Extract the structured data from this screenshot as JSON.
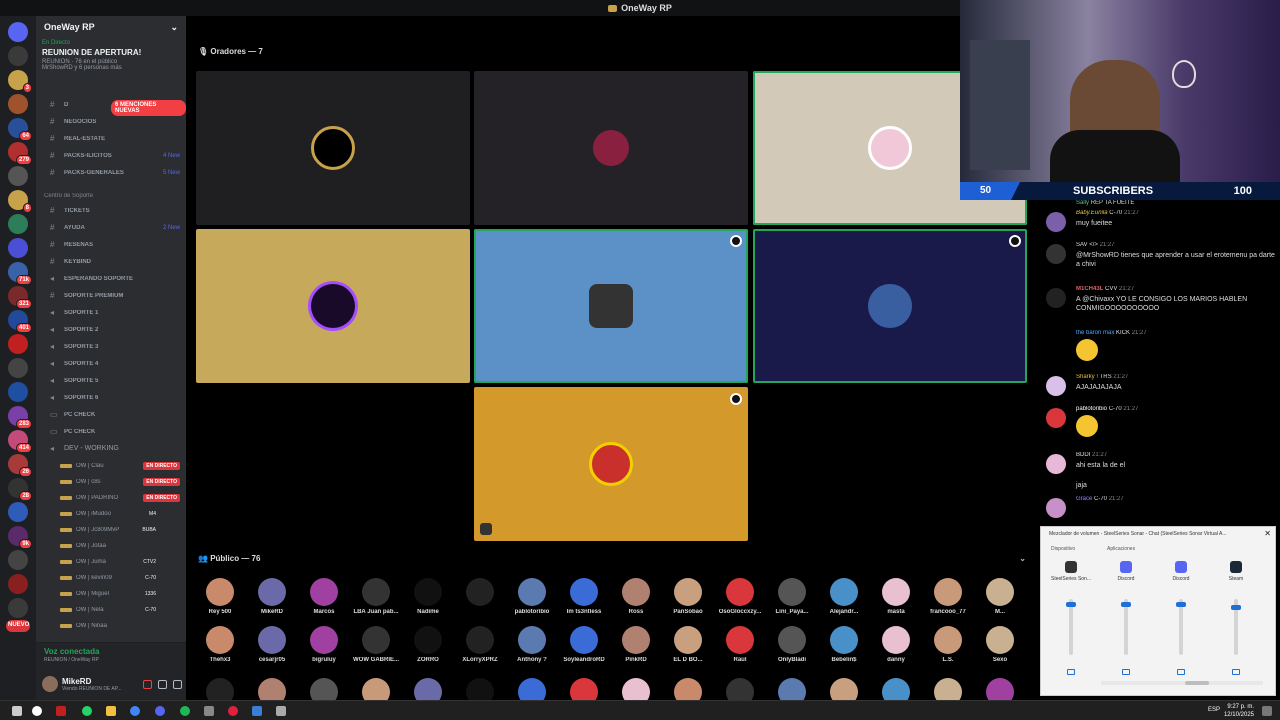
{
  "window": {
    "title": "OneWay RP"
  },
  "rail": {
    "badges": [
      "3",
      "64",
      "279",
      "8",
      "71k",
      "321",
      "401",
      "283",
      "414",
      "26",
      "28",
      "9k",
      "NUEVO"
    ]
  },
  "sidebar": {
    "server_name": "OneWay RP",
    "event": {
      "live_label": "En Directo",
      "title": "REUNION DE APERTURA!",
      "meta": "REUNION · 76 en el público",
      "hosts": "MrShowRD y 6 personas más"
    },
    "mentions_pill": "6 MENCIONES NUEVAS",
    "channels": [
      {
        "name": "D",
        "new": ""
      },
      {
        "name": "NEGOCIOS",
        "new": ""
      },
      {
        "name": "REAL-ESTATE",
        "new": ""
      },
      {
        "name": "PACKS-ILÍCITOS",
        "new": "4 New"
      },
      {
        "name": "PACKS-GENERALES",
        "new": "5 New"
      },
      {
        "name": "Centro de Soporte",
        "new": ""
      },
      {
        "name": "TICKETS",
        "new": ""
      },
      {
        "name": "AYUDA",
        "new": "2 New"
      },
      {
        "name": "RESEÑAS",
        "new": ""
      },
      {
        "name": "KEYBIND",
        "new": ""
      },
      {
        "name": "ESPERANDO SOPORTE",
        "new": ""
      },
      {
        "name": "SOPORTE PREMIUM",
        "new": ""
      },
      {
        "name": "SOPORTE 1",
        "new": ""
      },
      {
        "name": "SOPORTE 2",
        "new": ""
      },
      {
        "name": "SOPORTE 3",
        "new": ""
      },
      {
        "name": "SOPORTE 4",
        "new": ""
      },
      {
        "name": "SOPORTE 5",
        "new": ""
      },
      {
        "name": "SOPORTE 6",
        "new": ""
      },
      {
        "name": "PC CHECK",
        "new": ""
      },
      {
        "name": "PC CHECK",
        "new": ""
      },
      {
        "name": "DEV - WORKING",
        "new": ""
      }
    ],
    "voice_members": [
      {
        "name": "OW | Clau",
        "tag": "EN DIRECTO"
      },
      {
        "name": "OW | c8s",
        "tag": "EN DIRECTO"
      },
      {
        "name": "OW | PADRINO",
        "tag": "EN DIRECTO"
      },
      {
        "name": "OW | iMudoo",
        "tag": "M4"
      },
      {
        "name": "OW | Jc809MvP",
        "tag": "BUBA"
      },
      {
        "name": "OW | Jotaa",
        "tag": ""
      },
      {
        "name": "OW | Juma",
        "tag": "CTV2"
      },
      {
        "name": "OW | kevin09",
        "tag": "C-70"
      },
      {
        "name": "OW | Miguel",
        "tag": "1336"
      },
      {
        "name": "OW | Nela",
        "tag": "C-70"
      },
      {
        "name": "OW | Ninaa",
        "tag": ""
      }
    ],
    "voice_panel": {
      "status": "Voz conectada",
      "channel": "REUNION / OneWay RP",
      "user": "MikeRD",
      "user_status": "Viendo REUNION DE AP..."
    }
  },
  "stage": {
    "speakers_header": "Oradores — 7",
    "audience_header": "Público — 76",
    "tiles": [
      {
        "bg": "#1f1f22"
      },
      {
        "bg": "#242226"
      },
      {
        "bg": "#d3c9b8"
      },
      {
        "bg": "#c7a95b"
      },
      {
        "bg": "#5b91c6"
      },
      {
        "bg": "#191a4a"
      },
      {
        "bg": "#d39a2b"
      }
    ],
    "audience": [
      "Rey 500",
      "MikeRD",
      "Marcos",
      "LBA Juan pab...",
      "Nadime",
      "",
      "pablotoribio",
      "Im ts3ntless",
      "Ross",
      "PanSobao",
      "OsoGloccxzy...",
      "Lini_Paya...",
      "Alejandr...",
      "masta",
      "francooo_77",
      "M...",
      "Thehx3",
      "cesarjr05",
      "bigruluy",
      "WOW GABRIE...",
      "ZORRO",
      "XLorryXPRZ",
      "Anthony ?",
      "SoyleandroRD",
      "PinkRD",
      "EL D BO...",
      "Raúl",
      "OnlyBladi",
      "Bebelin$",
      "danny",
      "L.S.",
      "Sexo"
    ]
  },
  "stream": {
    "subs_current": "50",
    "subs_label": "SUBSCRIBERS",
    "subs_goal": "100",
    "subs_fraction": 0.5
  },
  "chat": {
    "messages": [
      {
        "user": "Sally",
        "badges": "REP",
        "time": "",
        "text": "TA FUEITE"
      },
      {
        "user": "Baby.Eunila",
        "badges": "C-70",
        "time": "21:27",
        "text": "muy fueitee"
      },
      {
        "user": "",
        "badges": "SAV </>",
        "time": "21:27",
        "text": "@MrShowRD tienes que aprender a usar el erotemenu pa darte a chivi"
      },
      {
        "user": "M1CH43L",
        "badges": "CVV",
        "time": "21:27",
        "text": "A @Chivaxx YO LE CONSIGO LOS MARIOS HABLEN CONMIGOOOOOOOOOO"
      },
      {
        "user": "the baron max",
        "badges": "KICK",
        "time": "21:27",
        "text": ""
      },
      {
        "user": "Sharky !",
        "badges": "TRS",
        "time": "21:27",
        "text": "AJAJAJAJAJA"
      },
      {
        "user": "pablotoribio",
        "badges": "C-70",
        "time": "21:27",
        "text": ""
      },
      {
        "user": "",
        "badges": "BDDI",
        "time": "21:27",
        "text": "ahi esta la de el"
      },
      {
        "user": "",
        "badges": "",
        "time": "",
        "text": "jaja"
      },
      {
        "user": "Grace",
        "badges": "C-70",
        "time": "21:27",
        "text": ""
      }
    ]
  },
  "mixer": {
    "title": "Mezclador de volumen - SteelSeries Sonar - Chat (SteelSeries Sonar Virtual A...",
    "section_device": "Dispositivo",
    "section_apps": "Aplicaciones",
    "channels": [
      {
        "name": "SteelSeries Son...",
        "level": 0.95
      },
      {
        "name": "Discord",
        "level": 0.95
      },
      {
        "name": "Discord",
        "level": 0.95
      },
      {
        "name": "Steam",
        "level": 0.9
      }
    ]
  },
  "taskbar": {
    "time": "9:27 p. m.",
    "date": "12/10/2025",
    "lang": "ESP"
  },
  "colors": {
    "discord_bg": "#2b2d31",
    "rail_bg": "#1e1f22",
    "live_red": "#da373c",
    "speaking_green": "#23a55a",
    "blurple": "#5865f2"
  }
}
